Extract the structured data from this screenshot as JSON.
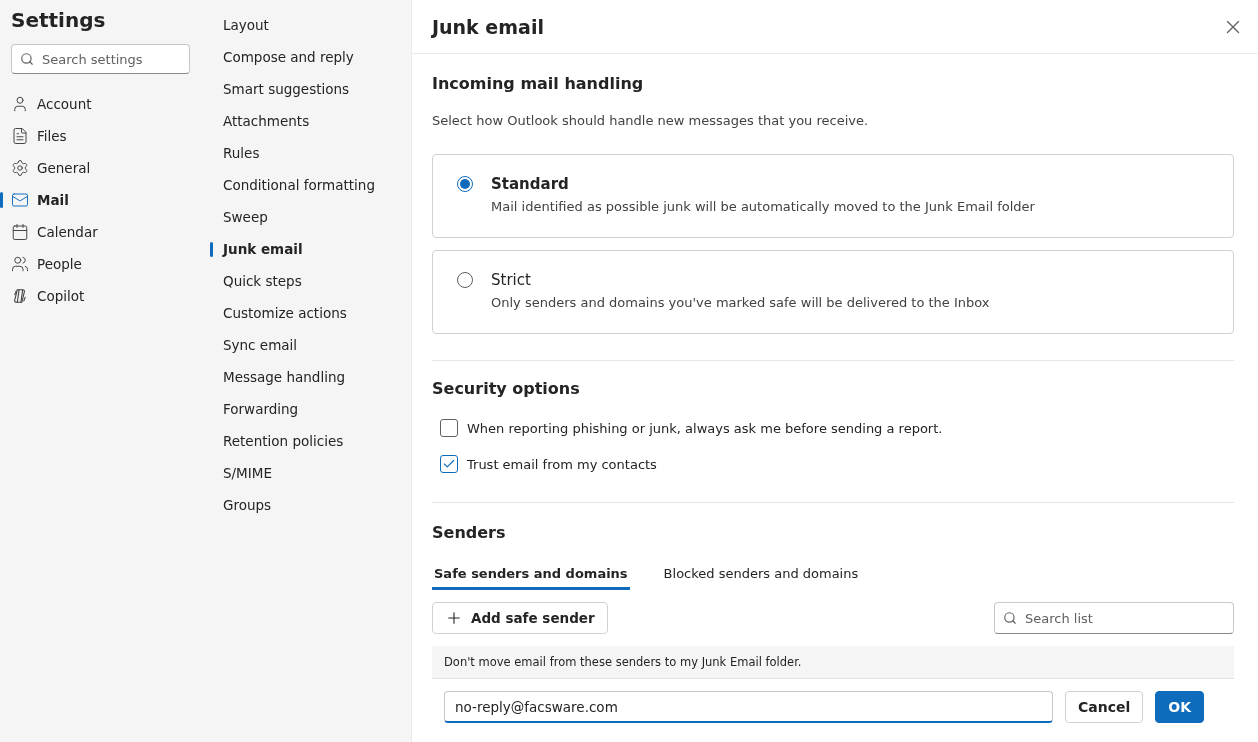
{
  "app_title": "Settings",
  "search": {
    "placeholder": "Search settings"
  },
  "nav": [
    {
      "label": "Account",
      "selected": false
    },
    {
      "label": "Files",
      "selected": false
    },
    {
      "label": "General",
      "selected": false
    },
    {
      "label": "Mail",
      "selected": true
    },
    {
      "label": "Calendar",
      "selected": false
    },
    {
      "label": "People",
      "selected": false
    },
    {
      "label": "Copilot",
      "selected": false
    }
  ],
  "subnav": [
    {
      "label": "Layout",
      "selected": false
    },
    {
      "label": "Compose and reply",
      "selected": false
    },
    {
      "label": "Smart suggestions",
      "selected": false
    },
    {
      "label": "Attachments",
      "selected": false
    },
    {
      "label": "Rules",
      "selected": false
    },
    {
      "label": "Conditional formatting",
      "selected": false
    },
    {
      "label": "Sweep",
      "selected": false
    },
    {
      "label": "Junk email",
      "selected": true
    },
    {
      "label": "Quick steps",
      "selected": false
    },
    {
      "label": "Customize actions",
      "selected": false
    },
    {
      "label": "Sync email",
      "selected": false
    },
    {
      "label": "Message handling",
      "selected": false
    },
    {
      "label": "Forwarding",
      "selected": false
    },
    {
      "label": "Retention policies",
      "selected": false
    },
    {
      "label": "S/MIME",
      "selected": false
    },
    {
      "label": "Groups",
      "selected": false
    }
  ],
  "panel": {
    "title": "Junk email",
    "incoming": {
      "heading": "Incoming mail handling",
      "description": "Select how Outlook should handle new messages that you receive.",
      "options": [
        {
          "title": "Standard",
          "description": "Mail identified as possible junk will be automatically moved to the Junk Email folder",
          "selected": true
        },
        {
          "title": "Strict",
          "description": "Only senders and domains you've marked safe will be delivered to the Inbox",
          "selected": false
        }
      ]
    },
    "security": {
      "heading": "Security options",
      "options": [
        {
          "label": "When reporting phishing or junk, always ask me before sending a report.",
          "checked": false
        },
        {
          "label": "Trust email from my contacts",
          "checked": true
        }
      ]
    },
    "senders": {
      "heading": "Senders",
      "tabs": [
        {
          "label": "Safe senders and domains",
          "selected": true
        },
        {
          "label": "Blocked senders and domains",
          "selected": false
        }
      ],
      "add_button": "Add safe sender",
      "search": {
        "placeholder": "Search list"
      },
      "note": "Don't move email from these senders to my Junk Email folder.",
      "entry": {
        "value": "no-reply@facsware.com"
      },
      "cancel": "Cancel",
      "ok": "OK"
    }
  }
}
